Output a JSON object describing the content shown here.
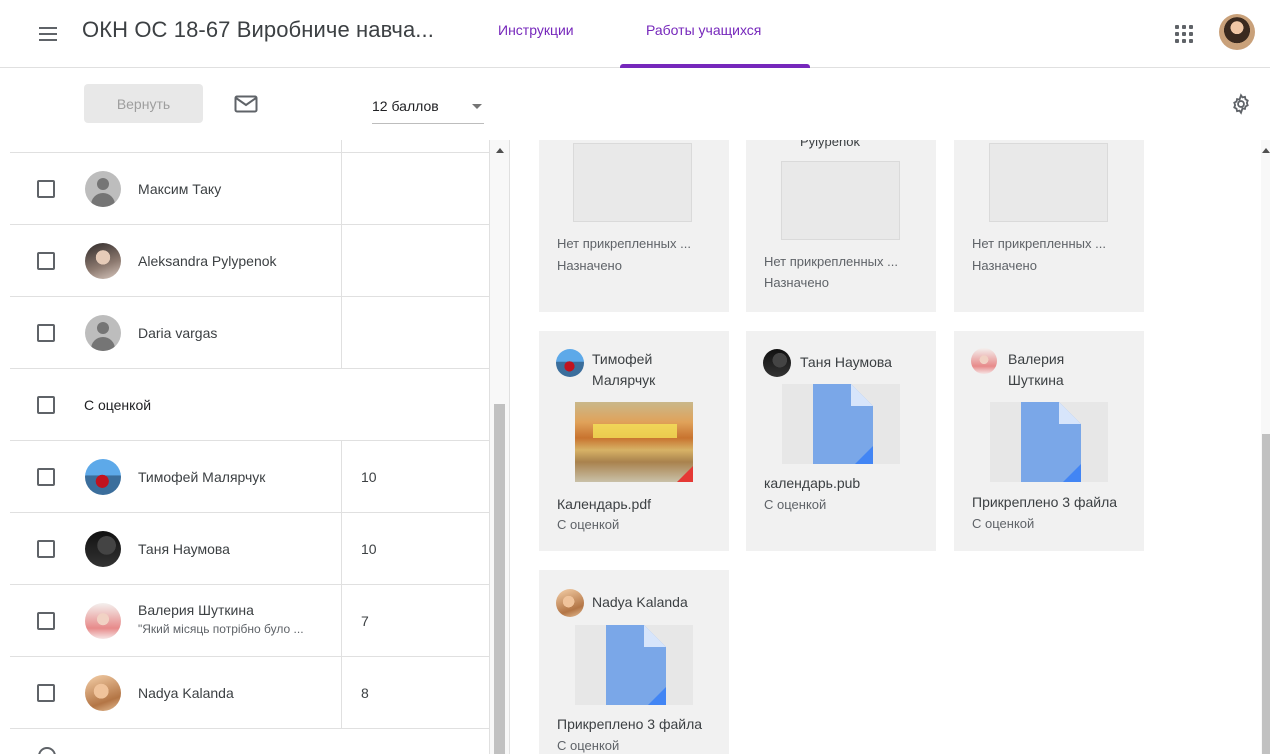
{
  "header": {
    "course_title": "ОКН ОС 18-67 Виробниче навча...",
    "tabs": [
      {
        "label": "Инструкции",
        "active": false
      },
      {
        "label": "Работы учащихся",
        "active": true
      }
    ],
    "accent_color": "#7627bb"
  },
  "toolbar": {
    "return_label": "Вернуть",
    "points_value": "12 баллов"
  },
  "roster": {
    "rows": [
      {
        "name": "Максим Таку",
        "grade": "",
        "avatar": "default-avatar"
      },
      {
        "name": "Aleksandra Pylypenok",
        "grade": "",
        "avatar": "photo"
      },
      {
        "name": "Daria vargas",
        "grade": "",
        "avatar": "default-avatar"
      }
    ],
    "section_label": "С оценкой",
    "graded_rows": [
      {
        "name": "Тимофей Малярчук",
        "grade": "10",
        "comment": ""
      },
      {
        "name": "Таня Наумова",
        "grade": "10",
        "comment": ""
      },
      {
        "name": "Валерия Шуткина",
        "grade": "7",
        "comment": "\"Який місяць потрібно було ..."
      },
      {
        "name": "Nadya Kalanda",
        "grade": "8",
        "comment": ""
      }
    ]
  },
  "gallery": {
    "top_cards": [
      {
        "attachment": "Нет прикрепленных ...",
        "status": "Назначено",
        "name_partial": ""
      },
      {
        "attachment": "Нет прикрепленных ...",
        "status": "Назначено",
        "name_partial": "Pylypenok"
      },
      {
        "attachment": "Нет прикрепленных ...",
        "status": "Назначено",
        "name_partial": ""
      }
    ],
    "cards": [
      {
        "name_line1": "Тимофей",
        "name_line2": "Малярчук",
        "title": "Календарь.pdf",
        "status": "С оценкой",
        "thumb": "image"
      },
      {
        "name_line1": "Таня Наумова",
        "name_line2": "",
        "title": "календарь.pub",
        "status": "С оценкой",
        "thumb": "doc-icon"
      },
      {
        "name_line1": "Валерия",
        "name_line2": "Шуткина",
        "title": "Прикреплено 3 файла",
        "status": "С оценкой",
        "thumb": "doc-icon"
      },
      {
        "name_line1": "Nadya Kalanda",
        "name_line2": "",
        "title": "Прикреплено 3 файла",
        "status": "С оценкой",
        "thumb": "doc-icon"
      }
    ],
    "doc_icon_color": "#7aa7e8",
    "doc_corner_color": "#4285f4"
  }
}
